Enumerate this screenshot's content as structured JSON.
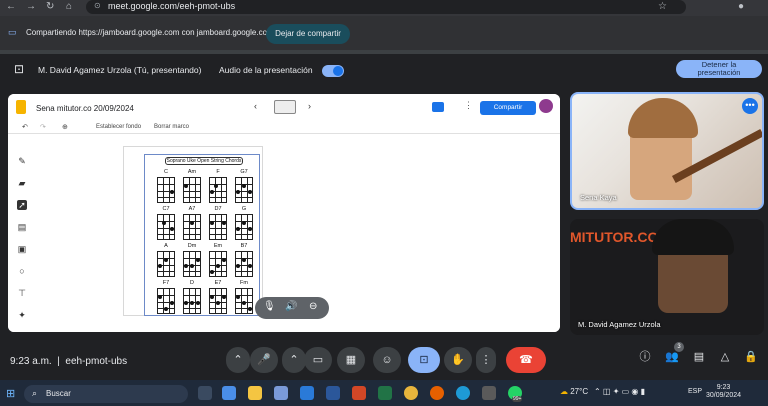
{
  "browser": {
    "url": "meet.google.com/eeh-pmot-ubs"
  },
  "share_banner": {
    "text": "Compartiendo https://jamboard.google.com con jamboard.google.com",
    "button": "Dejar de compartir"
  },
  "present_bar": {
    "presenter": "M. David Agamez Urzola (Tú, presentando)",
    "audio_label": "Audio de la presentación",
    "stop_button_line1": "Detener la",
    "stop_button_line2": "presentación"
  },
  "jamboard": {
    "title": "Sena mitutor.co 20/09/2024",
    "share": "Compartir",
    "set_background": "Establecer fondo",
    "clear_frame": "Borrar marco",
    "chart_title": "Soprano Uke Open String Chords",
    "chords": [
      "C",
      "Am",
      "F",
      "G7",
      "C7",
      "A7",
      "D7",
      "G",
      "A",
      "Dm",
      "Em",
      "B7",
      "F7",
      "D",
      "E7",
      "Fm"
    ]
  },
  "tiles": [
    {
      "name": "Sena Kaya"
    },
    {
      "name": "M. David Agamez Urzola"
    }
  ],
  "tile2_overlay": "MITUTOR.CO",
  "controls": {
    "time": "9:23 a.m.",
    "meeting_code": "eeh-pmot-ubs",
    "people_count": "3"
  },
  "taskbar": {
    "search": "Buscar",
    "weather": "27°C",
    "lang": "ESP",
    "time": "9:23",
    "date": "30/09/2024",
    "notif": "99+"
  }
}
